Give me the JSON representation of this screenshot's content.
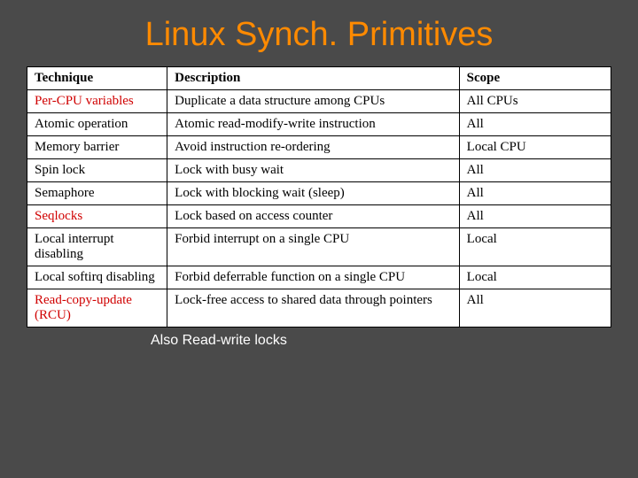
{
  "title": "Linux Synch. Primitives",
  "headers": {
    "technique": "Technique",
    "description": "Description",
    "scope": "Scope"
  },
  "rows": [
    {
      "technique": "Per-CPU variables",
      "highlight": true,
      "description": "Duplicate a data structure among CPUs",
      "scope": "All CPUs"
    },
    {
      "technique": "Atomic operation",
      "highlight": false,
      "description": "Atomic read-modify-write instruction",
      "scope": "All"
    },
    {
      "technique": "Memory barrier",
      "highlight": false,
      "description": "Avoid instruction re-ordering",
      "scope": "Local CPU"
    },
    {
      "technique": "Spin lock",
      "highlight": false,
      "description": "Lock with busy wait",
      "scope": "All"
    },
    {
      "technique": "Semaphore",
      "highlight": false,
      "description": "Lock with blocking wait (sleep)",
      "scope": "All"
    },
    {
      "technique": "Seqlocks",
      "highlight": true,
      "description": "Lock based on access counter",
      "scope": "All"
    },
    {
      "technique": "Local interrupt disabling",
      "highlight": false,
      "description": "Forbid interrupt on a single CPU",
      "scope": "Local"
    },
    {
      "technique": "Local softirq disabling",
      "highlight": false,
      "description": "Forbid deferrable function on a single CPU",
      "scope": "Local"
    },
    {
      "technique": "Read-copy-update (RCU)",
      "highlight": true,
      "description": "Lock-free access to shared data through pointers",
      "scope": "All"
    }
  ],
  "footnote": "Also Read-write locks"
}
